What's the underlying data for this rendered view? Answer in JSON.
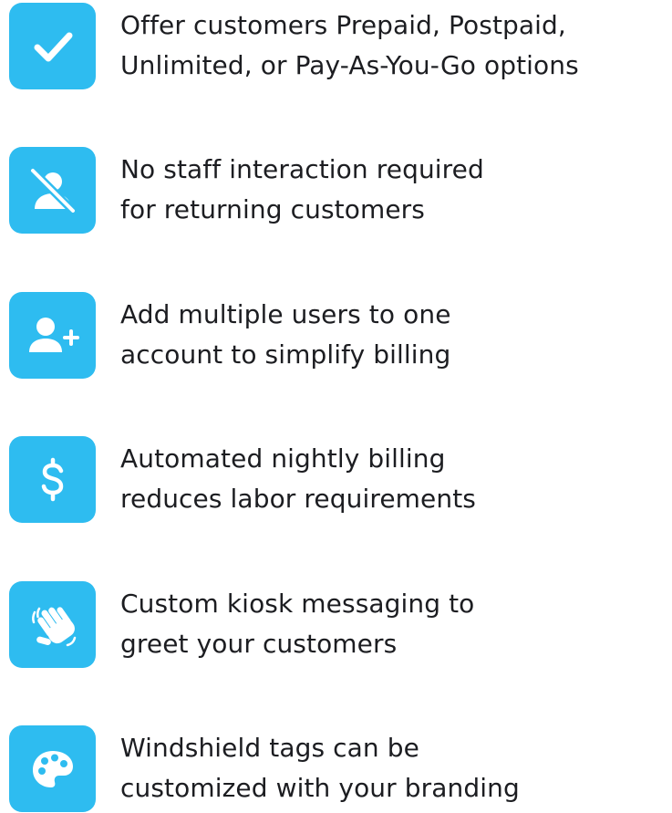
{
  "accent_color": "#2ebcf0",
  "text_color": "#1c1d21",
  "features": [
    {
      "icon": "checkmark-icon",
      "lines": [
        "Offer customers Prepaid, Postpaid,",
        "Unlimited, or Pay-As-You-Go options"
      ]
    },
    {
      "icon": "user-slash-icon",
      "lines": [
        "No staff interaction required",
        "for returning customers"
      ]
    },
    {
      "icon": "user-plus-icon",
      "lines": [
        "Add multiple users to one",
        "account to simplify billing"
      ]
    },
    {
      "icon": "dollar-icon",
      "lines": [
        "Automated nightly billing",
        "reduces labor requirements"
      ]
    },
    {
      "icon": "waving-hand-icon",
      "lines": [
        "Custom kiosk messaging to",
        "greet your customers"
      ]
    },
    {
      "icon": "palette-icon",
      "lines": [
        "Windshield tags can be",
        "customized with your branding"
      ]
    }
  ]
}
